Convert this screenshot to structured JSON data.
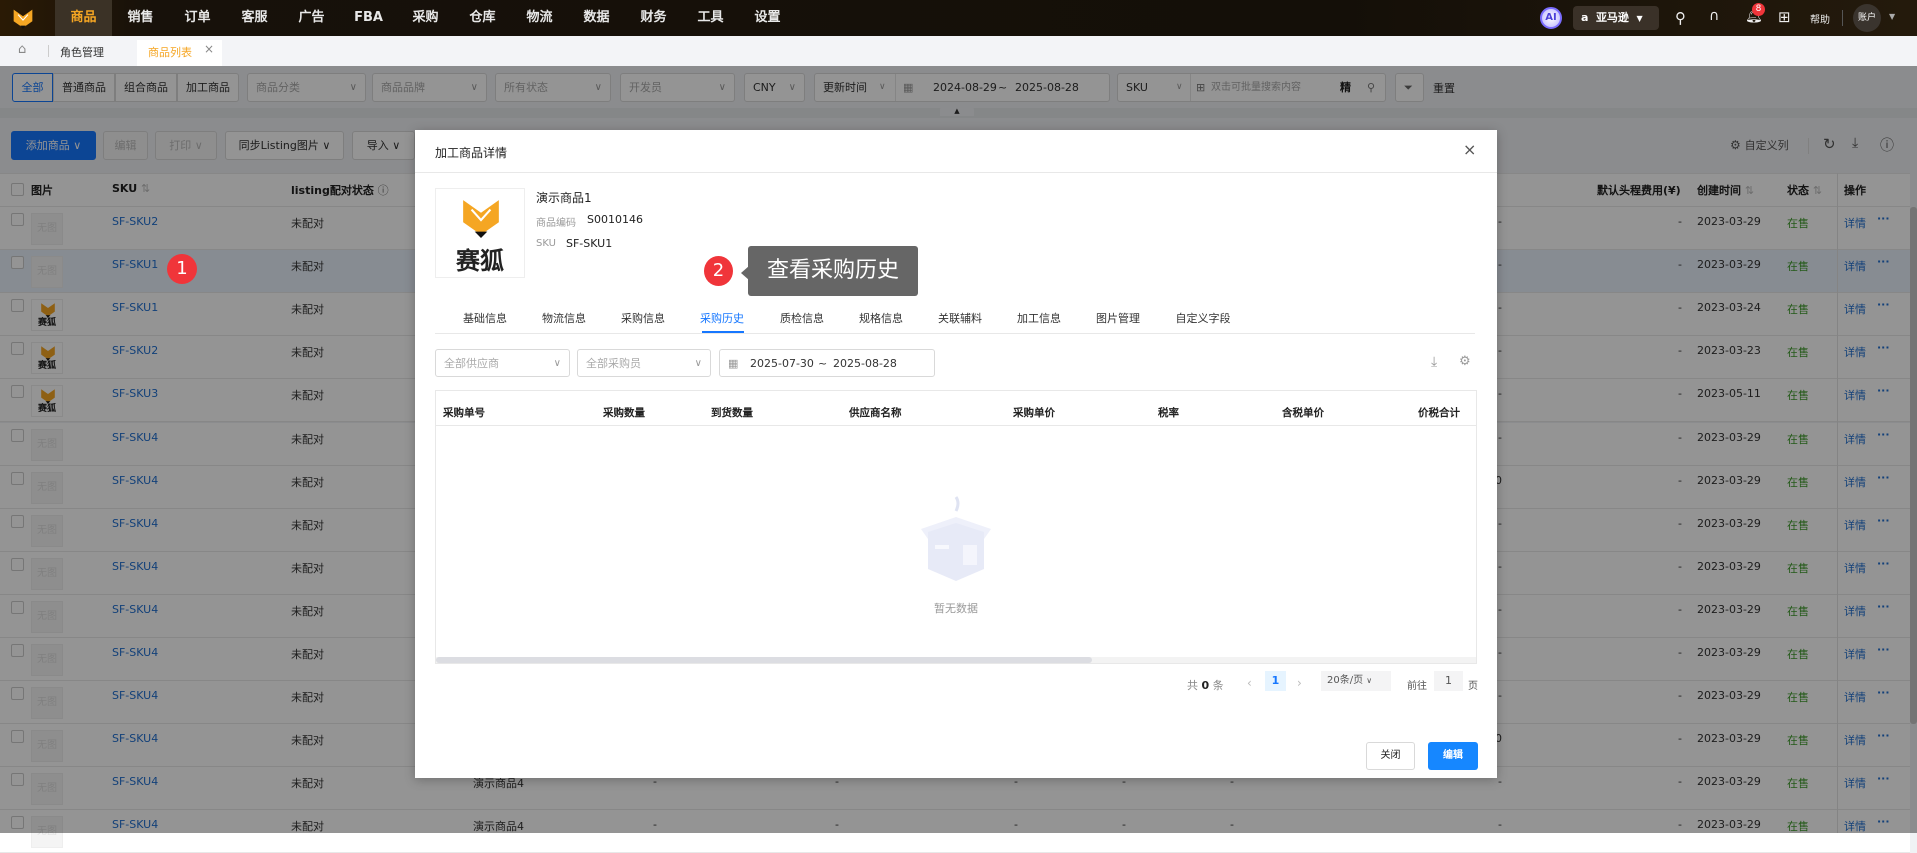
{
  "topnav": {
    "items": [
      "商品",
      "销售",
      "订单",
      "客服",
      "广告",
      "FBA",
      "采购",
      "仓库",
      "物流",
      "数据",
      "财务",
      "工具",
      "设置"
    ],
    "active": "商品",
    "ai_label": "AI",
    "platform": "亚马逊",
    "notification_count": "8",
    "help": "帮助",
    "account": "账户"
  },
  "tabs": {
    "items": [
      "角色管理",
      "商品列表"
    ],
    "close": "×"
  },
  "filters": {
    "segments": [
      "全部",
      "普通商品",
      "组合商品",
      "加工商品"
    ],
    "category": "商品分类",
    "brand": "商品品牌",
    "status": "所有状态",
    "developer": "开发员",
    "currency": "CNY",
    "time_type": "更新时间",
    "date_start": "2024-08-29",
    "date_sep": "~",
    "date_end": "2025-08-28",
    "search_field": "SKU",
    "search_placeholder": "双击可批量搜索内容",
    "exact": "精",
    "reset": "重置"
  },
  "toolbar": {
    "add": "添加商品",
    "edit": "编辑",
    "print": "打印",
    "sync": "同步Listing图片",
    "import": "导入",
    "custom_cols": "自定义列"
  },
  "table": {
    "headers": {
      "image": "图片",
      "sku": "SKU",
      "listing": "listing配对状态",
      "freight": "默认头程费用(¥)",
      "created": "创建时间",
      "status": "状态",
      "actions": "操作"
    },
    "no_image": "无图",
    "logo_text": "赛狐",
    "detail": "详情",
    "more": "···",
    "rows": [
      {
        "sku": "SF-SKU2",
        "listing": "未配对",
        "img": "none",
        "partial": "-",
        "freight": "-",
        "created": "2023-03-29",
        "status": "在售"
      },
      {
        "sku": "SF-SKU1",
        "listing": "未配对",
        "img": "none",
        "partial": "-",
        "freight": "-",
        "created": "2023-03-29",
        "status": "在售",
        "highlight": true
      },
      {
        "sku": "SF-SKU1",
        "listing": "未配对",
        "img": "logo",
        "partial": "-",
        "freight": "-",
        "created": "2023-03-24",
        "status": "在售"
      },
      {
        "sku": "SF-SKU2",
        "listing": "未配对",
        "img": "logo",
        "partial": "-",
        "freight": "-",
        "created": "2023-03-23",
        "status": "在售"
      },
      {
        "sku": "SF-SKU3",
        "listing": "未配对",
        "img": "logo",
        "partial": "-",
        "freight": "-",
        "created": "2023-05-11",
        "status": "在售"
      },
      {
        "sku": "SF-SKU4",
        "listing": "未配对",
        "img": "none",
        "partial": "-",
        "freight": "-",
        "created": "2023-03-29",
        "status": "在售"
      },
      {
        "sku": "SF-SKU4",
        "listing": "未配对",
        "img": "none",
        "partial": "0",
        "freight": "-",
        "created": "2023-03-29",
        "status": "在售"
      },
      {
        "sku": "SF-SKU4",
        "listing": "未配对",
        "img": "none",
        "partial": "-",
        "freight": "-",
        "created": "2023-03-29",
        "status": "在售"
      },
      {
        "sku": "SF-SKU4",
        "listing": "未配对",
        "img": "none",
        "partial": "-",
        "freight": "-",
        "created": "2023-03-29",
        "status": "在售"
      },
      {
        "sku": "SF-SKU4",
        "listing": "未配对",
        "img": "none",
        "partial": "-",
        "freight": "-",
        "created": "2023-03-29",
        "status": "在售"
      },
      {
        "sku": "SF-SKU4",
        "listing": "未配对",
        "img": "none",
        "partial": "-",
        "freight": "-",
        "created": "2023-03-29",
        "status": "在售"
      },
      {
        "sku": "SF-SKU4",
        "listing": "未配对",
        "img": "none",
        "partial": "-",
        "freight": "-",
        "created": "2023-03-29",
        "status": "在售"
      },
      {
        "sku": "SF-SKU4",
        "listing": "未配对",
        "img": "none",
        "partial": "0",
        "freight": "-",
        "created": "2023-03-29",
        "status": "在售"
      },
      {
        "sku": "SF-SKU4",
        "listing": "未配对",
        "img": "none",
        "partial": "-",
        "freight": "-",
        "created": "2023-03-29",
        "status": "在售",
        "name": "演示商品4",
        "mid": [
          "-",
          "-",
          "-",
          "-",
          "-"
        ]
      },
      {
        "sku": "SF-SKU4",
        "listing": "未配对",
        "img": "none",
        "partial": "-",
        "freight": "-",
        "created": "2023-03-29",
        "status": "在售",
        "name": "演示商品4",
        "mid": [
          "-",
          "-",
          "-",
          "-",
          "-"
        ]
      }
    ]
  },
  "annotations": {
    "step1": "1",
    "step2": "2",
    "tooltip": "查看采购历史"
  },
  "modal": {
    "title": "加工商品详情",
    "close": "×",
    "product": {
      "name": "演示商品1",
      "code_label": "商品编码",
      "code": "S0010146",
      "sku_label": "SKU",
      "sku": "SF-SKU1",
      "logo_text": "赛狐"
    },
    "tabs": [
      "基础信息",
      "物流信息",
      "采购信息",
      "采购历史",
      "质检信息",
      "规格信息",
      "关联辅料",
      "加工信息",
      "图片管理",
      "自定义字段"
    ],
    "active_tab": "采购历史",
    "filters": {
      "supplier": "全部供应商",
      "buyer": "全部采购员",
      "date_start": "2025-07-30",
      "date_sep": "~",
      "date_end": "2025-08-28"
    },
    "columns": [
      "采购单号",
      "采购数量",
      "到货数量",
      "供应商名称",
      "采购单价",
      "税率",
      "含税单价",
      "价税合计"
    ],
    "empty": "暂无数据",
    "pagination": {
      "total_prefix": "共",
      "total": "0",
      "total_suffix": "条",
      "page": "1",
      "page_size": "20条/页",
      "goto": "前往",
      "goto_value": "1",
      "goto_suffix": "页"
    },
    "buttons": {
      "close": "关闭",
      "edit": "编辑"
    }
  },
  "colors": {
    "accent": "#1677ff",
    "brand": "#f5a623",
    "status_on_sale": "#3f9b2c",
    "badge": "#f0353a"
  }
}
